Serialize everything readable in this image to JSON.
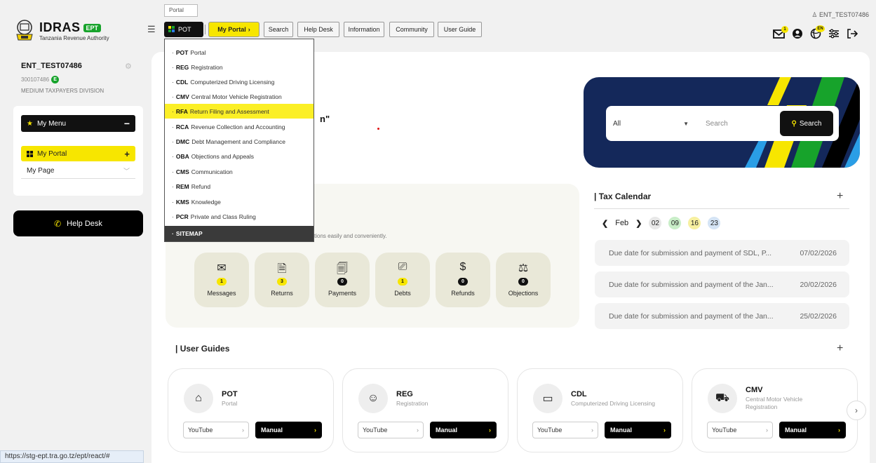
{
  "logo": {
    "name": "IDRAS",
    "badge": "EPT",
    "org": "Tanzania Revenue Authority"
  },
  "user": {
    "name": "ENT_TEST07486",
    "tin": "300107486",
    "tin_badge": "E",
    "division": "MEDIUM TAXPAYERS DIVISION"
  },
  "sidebar": {
    "my_menu": "My Menu",
    "my_portal": "My Portal",
    "my_page": "My Page",
    "help_desk": "Help Desk"
  },
  "nav": {
    "tooltip": "Portal",
    "pot": "POT",
    "my_portal": "My Portal",
    "items": [
      "Search",
      "Help Desk",
      "Information",
      "Community",
      "User Guide"
    ]
  },
  "account": "ENT_TEST07486",
  "top_badges": {
    "mail": "1",
    "lang": "EN"
  },
  "dropdown": {
    "items": [
      {
        "code": "POT",
        "label": "Portal"
      },
      {
        "code": "REG",
        "label": "Registration"
      },
      {
        "code": "CDL",
        "label": "Computerized Driving Licensing"
      },
      {
        "code": "CMV",
        "label": "Central Motor Vehicle Registration"
      },
      {
        "code": "RFA",
        "label": "Return Filing and Assessment",
        "active": true
      },
      {
        "code": "RCA",
        "label": "Revenue Collection and Accounting"
      },
      {
        "code": "DMC",
        "label": "Debt Management and Compliance"
      },
      {
        "code": "OBA",
        "label": "Objections and Appeals"
      },
      {
        "code": "CMS",
        "label": "Communication"
      },
      {
        "code": "REM",
        "label": "Refund"
      },
      {
        "code": "KMS",
        "label": "Knowledge"
      },
      {
        "code": "PCR",
        "label": "Private and Class Ruling"
      }
    ],
    "sitemap": "SITEMAP"
  },
  "hero_text": "n\"",
  "search": {
    "category": "All",
    "placeholder": "Search",
    "button": "Search"
  },
  "stats": {
    "description": "tions easily and conveniently.",
    "items": [
      {
        "label": "Messages",
        "count": "1",
        "style": "yellow"
      },
      {
        "label": "Returns",
        "count": "3",
        "style": "yellow"
      },
      {
        "label": "Payments",
        "count": "0",
        "style": "black"
      },
      {
        "label": "Debts",
        "count": "1",
        "style": "yellow"
      },
      {
        "label": "Refunds",
        "count": "0",
        "style": "black"
      },
      {
        "label": "Objections",
        "count": "0",
        "style": "black"
      }
    ]
  },
  "tax_calendar": {
    "title": "Tax Calendar",
    "month": "Feb",
    "days": [
      {
        "day": "02",
        "color": "#e8e8e8"
      },
      {
        "day": "09",
        "color": "#c9eec8"
      },
      {
        "day": "16",
        "color": "#f7f0a0"
      },
      {
        "day": "23",
        "color": "#d5e4f5"
      }
    ],
    "entries": [
      {
        "text": "Due date for submission and payment of SDL, P...",
        "date": "07/02/2026"
      },
      {
        "text": "Due date for submission and payment of the Jan...",
        "date": "20/02/2026"
      },
      {
        "text": "Due date for submission and payment of the Jan...",
        "date": "25/02/2026"
      }
    ]
  },
  "user_guides": {
    "title": "User Guides",
    "youtube": "YouTube",
    "manual": "Manual",
    "items": [
      {
        "code": "POT",
        "name": "Portal"
      },
      {
        "code": "REG",
        "name": "Registration"
      },
      {
        "code": "CDL",
        "name": "Computerized Driving Licensing"
      },
      {
        "code": "CMV",
        "name": "Central Motor Vehicle Registration"
      }
    ]
  },
  "status_url": "https://stg-ept.tra.go.tz/ept/react/#",
  "colors": {
    "accent": "#f7e600",
    "dark": "#111111",
    "banner": "#14285a",
    "active_item": "#fbef26"
  }
}
